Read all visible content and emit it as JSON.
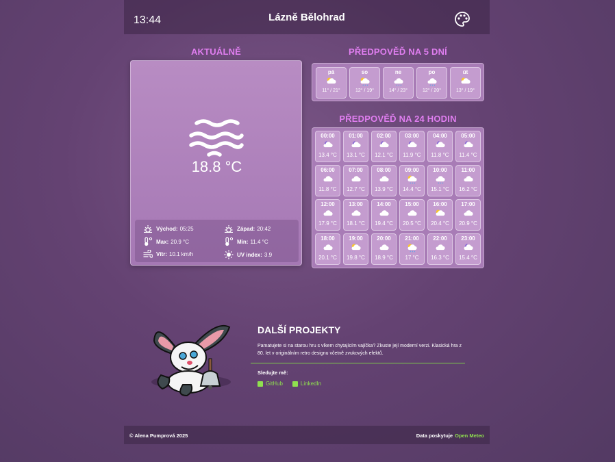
{
  "header": {
    "time": "13:44",
    "city": "Lázně Bělohrad",
    "theme_icon": "palette-icon"
  },
  "current": {
    "title": "AKTUÁLNĚ",
    "icon": "fog-icon",
    "temperature": "18.8 °C",
    "details": {
      "sunrise_label": "Východ:",
      "sunrise": "05:25",
      "sunset_label": "Západ:",
      "sunset": "20:42",
      "max_label": "Max:",
      "max": "20.9 °C",
      "min_label": "Min:",
      "min": "11.4 °C",
      "wind_label": "Vítr:",
      "wind": "10.1 km/h",
      "uv_label": "UV index:",
      "uv": "3.9"
    }
  },
  "forecast5": {
    "title": "PŘEDPOVĚĎ NA 5 DNÍ",
    "days": [
      {
        "name": "pá",
        "icon": "sun-cloud-icon",
        "range": "11° / 21°"
      },
      {
        "name": "so",
        "icon": "sun-cloud-rain-icon",
        "range": "12° / 19°"
      },
      {
        "name": "ne",
        "icon": "cloud-rain-icon",
        "range": "14° / 23°"
      },
      {
        "name": "po",
        "icon": "cloud-rain-icon",
        "range": "12° / 20°"
      },
      {
        "name": "út",
        "icon": "sun-cloud-icon",
        "range": "13° / 19°"
      }
    ]
  },
  "hourly": {
    "title": "PŘEDPOVĚĎ NA 24 HODIN",
    "hours": [
      {
        "time": "00:00",
        "icon": "moon-cloud-icon",
        "temp": "13.4 °C"
      },
      {
        "time": "01:00",
        "icon": "moon-cloud-icon",
        "temp": "13.1 °C"
      },
      {
        "time": "02:00",
        "icon": "moon-cloud-icon",
        "temp": "12.1 °C"
      },
      {
        "time": "03:00",
        "icon": "moon-cloud-icon",
        "temp": "11.9 °C"
      },
      {
        "time": "04:00",
        "icon": "moon-cloud-icon",
        "temp": "11.8 °C"
      },
      {
        "time": "05:00",
        "icon": "moon-cloud-icon",
        "temp": "11.4 °C"
      },
      {
        "time": "06:00",
        "icon": "cloud-icon",
        "temp": "11.8 °C"
      },
      {
        "time": "07:00",
        "icon": "cloud-icon",
        "temp": "12.7 °C"
      },
      {
        "time": "08:00",
        "icon": "cloud-icon",
        "temp": "13.9 °C"
      },
      {
        "time": "09:00",
        "icon": "sun-cloud-rain-icon",
        "temp": "14.4 °C"
      },
      {
        "time": "10:00",
        "icon": "cloud-rain-icon",
        "temp": "15.1 °C"
      },
      {
        "time": "11:00",
        "icon": "cloud-icon",
        "temp": "16.2 °C"
      },
      {
        "time": "12:00",
        "icon": "cloud-icon",
        "temp": "17.9 °C"
      },
      {
        "time": "13:00",
        "icon": "cloud-icon",
        "temp": "18.1 °C"
      },
      {
        "time": "14:00",
        "icon": "cloud-icon",
        "temp": "19.4 °C"
      },
      {
        "time": "15:00",
        "icon": "cloud-icon",
        "temp": "20.5 °C"
      },
      {
        "time": "16:00",
        "icon": "sun-cloud-icon",
        "temp": "20.4 °C"
      },
      {
        "time": "17:00",
        "icon": "cloud-icon",
        "temp": "20.9 °C"
      },
      {
        "time": "18:00",
        "icon": "cloud-icon",
        "temp": "20.1 °C"
      },
      {
        "time": "19:00",
        "icon": "sun-cloud-icon",
        "temp": "19.8 °C"
      },
      {
        "time": "20:00",
        "icon": "cloud-icon",
        "temp": "18.9 °C"
      },
      {
        "time": "21:00",
        "icon": "sun-cloud-rain-icon",
        "temp": "17 °C"
      },
      {
        "time": "22:00",
        "icon": "cloud-icon",
        "temp": "16.3 °C"
      },
      {
        "time": "23:00",
        "icon": "moon-cloud-icon",
        "temp": "15.4 °C"
      }
    ]
  },
  "projects": {
    "title": "DALŠÍ PROJEKTY",
    "description": "Pamatujete si na starou hru s vlkem chytajícím vajíčka? Zkuste její moderní verzi. Klasická hra z 80. let v originálním retro designu včetně zvukových efektů.",
    "follow_label": "Sledujte mě:",
    "links": [
      {
        "label": "GitHub",
        "icon": "github-icon"
      },
      {
        "label": "LinkedIn",
        "icon": "linkedin-icon"
      }
    ]
  },
  "footer": {
    "copyright": "© Alena Pumprová 2025",
    "credit_label": "Data poskytuje",
    "credit_link": "Open Meteo"
  },
  "colors": {
    "accent": "#e07ef0",
    "link": "#8fe04f",
    "card": "#b88cc3",
    "tile": "#c49ccf"
  }
}
